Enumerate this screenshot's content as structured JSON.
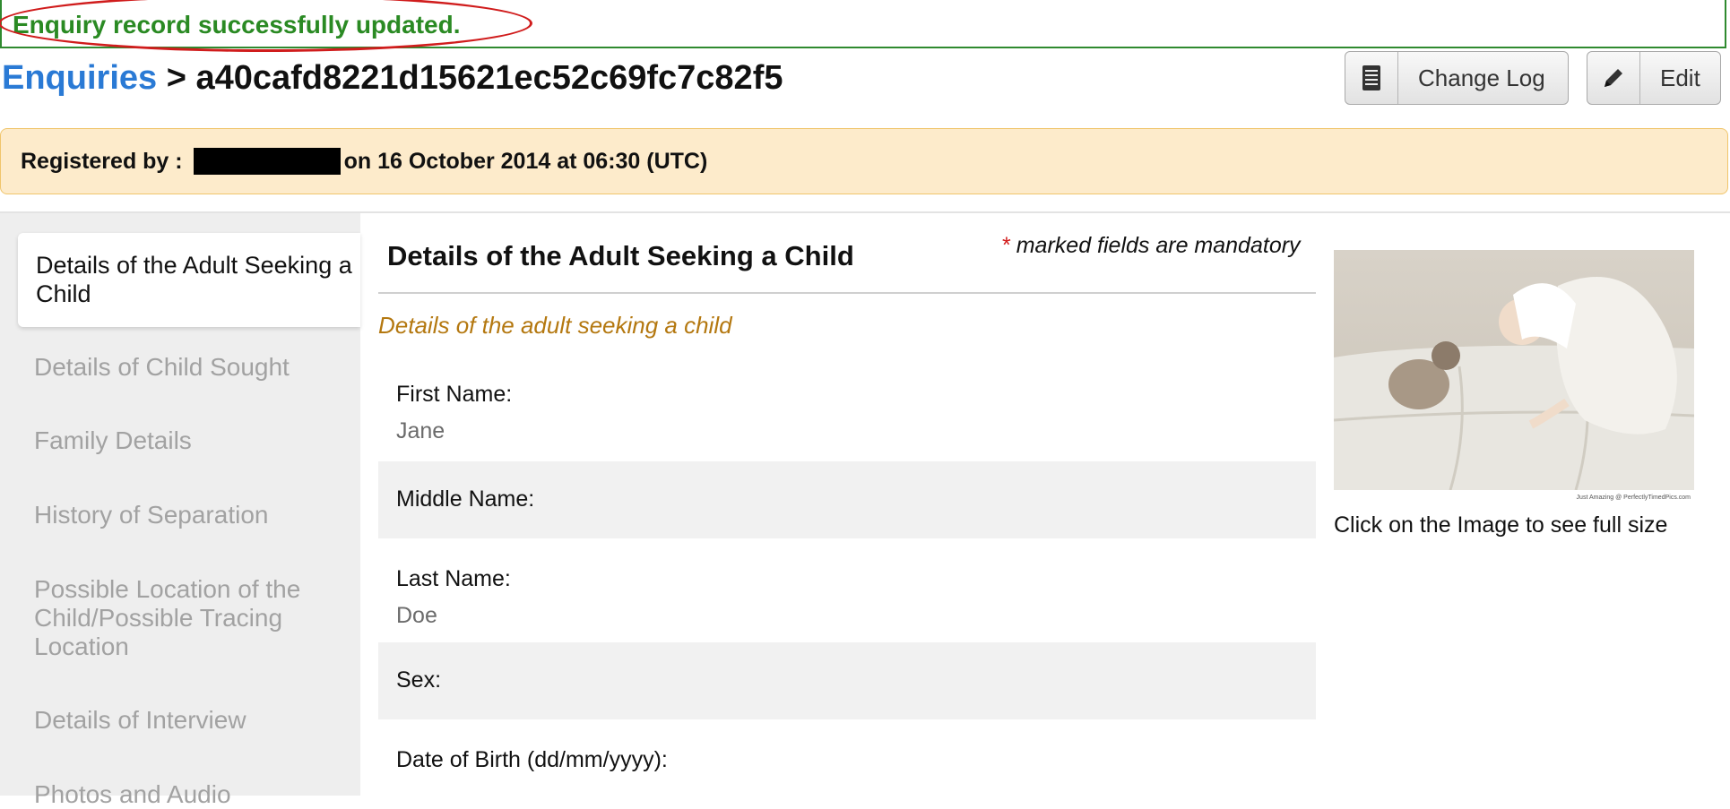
{
  "flash": {
    "message": "Enquiry record successfully updated."
  },
  "breadcrumb": {
    "parent": "Enquiries",
    "separator": ">",
    "record_id": "a40cafd8221d15621ec52c69fc7c82f5"
  },
  "toolbar": {
    "change_log_label": "Change Log",
    "edit_label": "Edit"
  },
  "registered": {
    "prefix": "Registered by :",
    "suffix": "on 16 October 2014 at 06:30 (UTC)"
  },
  "sidebar": {
    "items": [
      {
        "label": "Details of the Adult Seeking a Child",
        "active": true
      },
      {
        "label": "Details of Child Sought",
        "active": false
      },
      {
        "label": "Family Details",
        "active": false
      },
      {
        "label": "History of Separation",
        "active": false
      },
      {
        "label": "Possible Location of the Child/Possible Tracing Location",
        "active": false
      },
      {
        "label": "Details of Interview",
        "active": false
      },
      {
        "label": "Photos and Audio",
        "active": false
      }
    ]
  },
  "main": {
    "section_title": "Details of the Adult Seeking a Child",
    "mandatory_note": "marked fields are mandatory",
    "mandatory_star": "*",
    "subsection": "Details of the adult seeking a child",
    "fields": [
      {
        "label": "First Name:",
        "value": "Jane"
      },
      {
        "label": "Middle Name:",
        "value": ""
      },
      {
        "label": "Last Name:",
        "value": "Doe"
      },
      {
        "label": "Sex:",
        "value": ""
      },
      {
        "label": "Date of Birth (dd/mm/yyyy):",
        "value": ""
      }
    ]
  },
  "photo": {
    "watermark": "Just Amazing @ PerfectlyTimedPics.com",
    "caption": "Click on the Image to see full size"
  },
  "colors": {
    "link": "#2a7ad5",
    "success": "#2a8a23",
    "highlight": "#d01c1c",
    "notice_bg": "#fdebcb",
    "subsection": "#b47810"
  },
  "icons": {
    "change_log": "document-list-icon",
    "edit": "pencil-icon"
  }
}
